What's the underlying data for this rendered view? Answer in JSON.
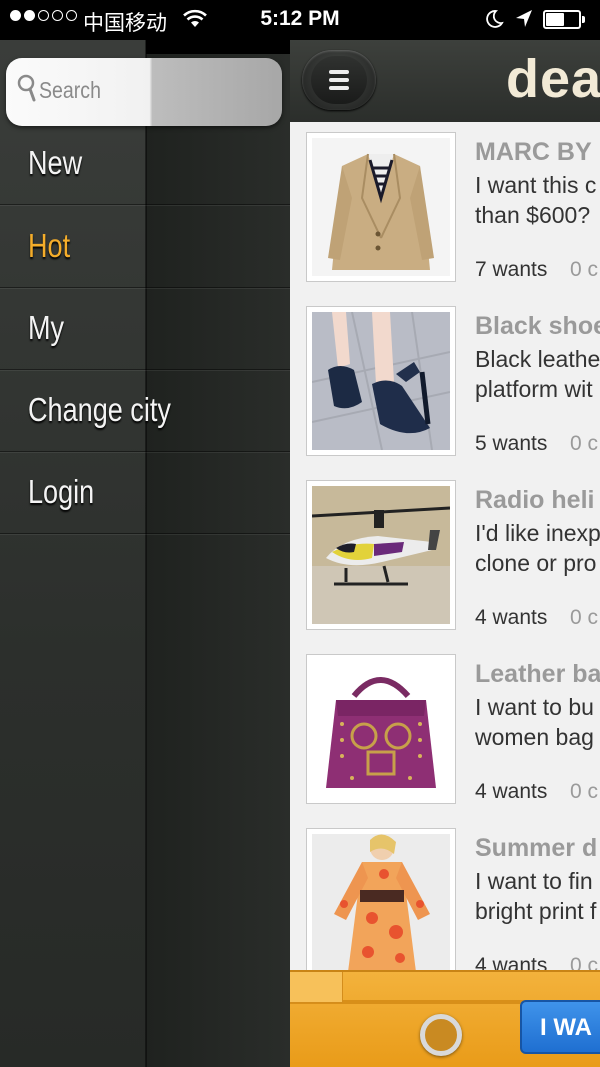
{
  "status_bar": {
    "carrier": "中国移动",
    "time": "5:12 PM",
    "signal_dots_on": 2,
    "signal_dots_total": 5
  },
  "menu": {
    "search_placeholder": "Search",
    "items": [
      {
        "label": "New",
        "active": false
      },
      {
        "label": "Hot",
        "active": true
      },
      {
        "label": "My",
        "active": false
      },
      {
        "label": "Change city",
        "active": false
      },
      {
        "label": "Login",
        "active": false
      }
    ],
    "active_color": "#f5ad2a"
  },
  "header": {
    "logo_text": "deal"
  },
  "listings": [
    {
      "title": "MARC BY",
      "description": "I want this c\nthan $600?",
      "wants": "7 wants",
      "comments": "0 c",
      "image": "jacket"
    },
    {
      "title": "Black shoe",
      "description": "Black leathe\nplatform wit",
      "wants": "5 wants",
      "comments": "0 c",
      "image": "shoes"
    },
    {
      "title": "Radio heli",
      "description": "I'd like inexp\nclone or pro",
      "wants": "4 wants",
      "comments": "0 c",
      "image": "helicopter"
    },
    {
      "title": "Leather ba",
      "description": "I want to bu\nwomen bag",
      "wants": "4 wants",
      "comments": "0 c",
      "image": "handbag"
    },
    {
      "title": "Summer d",
      "description": "I want to fin\nbright print f",
      "wants": "4 wants",
      "comments": "0 c",
      "image": "dress"
    }
  ],
  "bottom_bar": {
    "i_want_label": "I WA",
    "bar_color": "#eea52a",
    "button_color": "#2b7fe0"
  }
}
